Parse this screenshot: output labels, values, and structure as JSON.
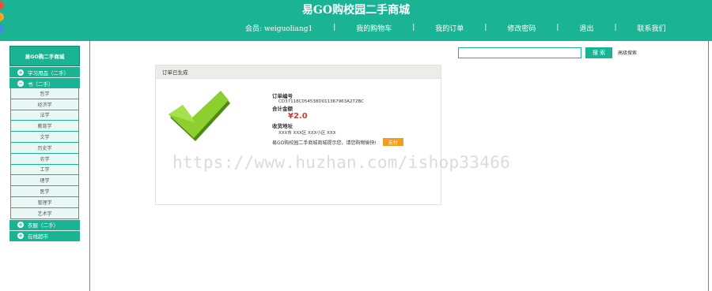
{
  "header": {
    "title": "易GO购校园二手商城",
    "nav": [
      "会员: weiguoliang1",
      "我的购物车",
      "我的订单",
      "修改密码",
      "退出",
      "联系我们"
    ],
    "separator": "|"
  },
  "colors": {
    "brand": "#1ab394",
    "pay_button": "#f39c20",
    "amount": "#dd3333"
  },
  "sidebar": {
    "title": "易GO购二手商城",
    "categories": [
      {
        "label": "学习用品（二手）",
        "icon": "plus-icon"
      },
      {
        "label": "书（二手）",
        "icon": "minus-icon"
      }
    ],
    "subcategories": [
      "哲学",
      "经济学",
      "法学",
      "教育学",
      "文学",
      "历史学",
      "农学",
      "工学",
      "理学",
      "医学",
      "管理学",
      "艺术学"
    ],
    "bottom_categories": [
      {
        "label": "衣服（二手）",
        "icon": "plus-icon"
      },
      {
        "label": "在线超市",
        "icon": "plus-icon"
      }
    ]
  },
  "search": {
    "value": "",
    "button": "搜 索",
    "advanced": "高级搜索"
  },
  "order": {
    "panel_title": "订单已生成",
    "number_label": "订单编号",
    "number_value": "CD37118C054538D011367963A272BC",
    "total_label": "合计金额",
    "total_value": "¥2.0",
    "address_label": "收货地址",
    "address_value": "XXX市 XXX区 XXX小区 XXX",
    "pay_message": "易GO购校园二手商城商城提示您，请您购物愉快!",
    "pay_button": "支付"
  },
  "watermark": "https://www.huzhan.com/ishop33466"
}
